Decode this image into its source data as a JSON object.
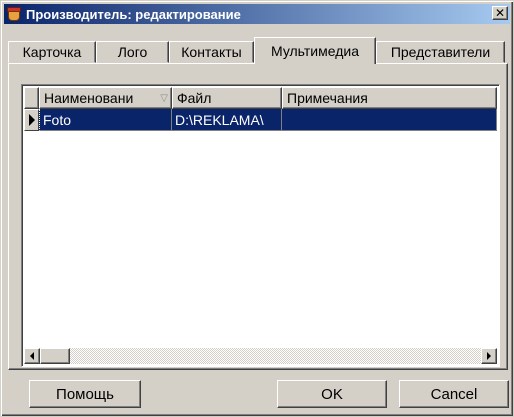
{
  "window": {
    "title": "Производитель: редактирование",
    "close_symbol": "✕"
  },
  "tabs": [
    {
      "label": "Карточка",
      "active": false
    },
    {
      "label": "Лого",
      "active": false
    },
    {
      "label": "Контакты",
      "active": false
    },
    {
      "label": "Мультимедиа",
      "active": true
    },
    {
      "label": "Представители",
      "active": false
    }
  ],
  "grid": {
    "columns": [
      "Наименовани",
      "Файл",
      "Примечания"
    ],
    "sort_indicator": "▽",
    "rows": [
      {
        "name": "Foto",
        "file": "D:\\REKLAMA\\",
        "notes": "",
        "selected": true
      }
    ]
  },
  "buttons": {
    "help": "Помощь",
    "ok": "OK",
    "cancel": "Cancel"
  },
  "icons": {
    "app": "app-cup-icon",
    "close": "close-icon",
    "row_pointer": "row-pointer-icon",
    "scroll_left": "scroll-left-arrow-icon",
    "scroll_right": "scroll-right-arrow-icon"
  },
  "colors": {
    "selection": "#0a246a",
    "face": "#d4d0c8",
    "title_gradient_start": "#0a246a",
    "title_gradient_end": "#a6caf0"
  }
}
